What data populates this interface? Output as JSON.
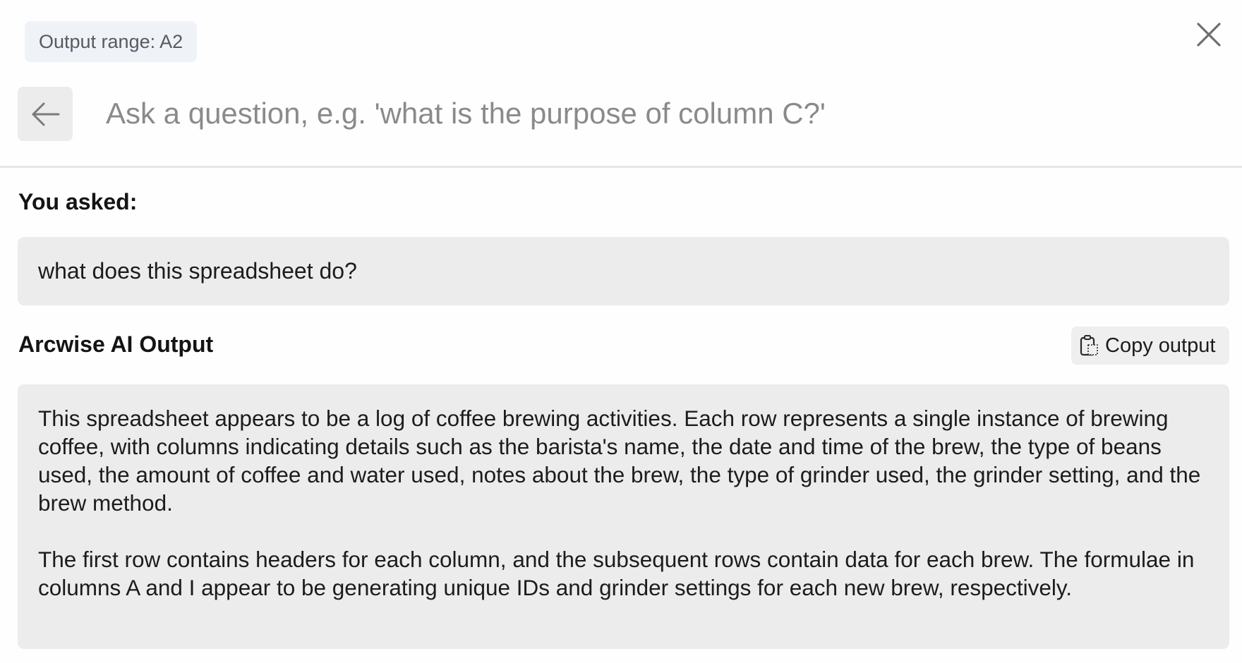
{
  "header": {
    "output_range_label": "Output range: A2",
    "close_icon": "close-icon"
  },
  "ask": {
    "back_icon": "arrow-left-icon",
    "placeholder": "Ask a question, e.g. 'what is the purpose of column C?'",
    "value": ""
  },
  "question": {
    "label": "You asked:",
    "text": "what does this spreadsheet do?"
  },
  "output": {
    "label": "Arcwise AI Output",
    "copy_button": {
      "icon": "clipboard-copy-icon",
      "label": "Copy output"
    },
    "paragraphs": [
      "This spreadsheet appears to be a log of coffee brewing activities. Each row represents a single instance of brewing coffee, with columns indicating details such as the barista's name, the date and time of the brew, the type of beans used, the amount of coffee and water used, notes about the brew, the type of grinder used, the grinder setting, and the brew method.",
      "The first row contains headers for each column, and the subsequent rows contain data for each brew. The formulae in columns A and I appear to be generating unique IDs and grinder settings for each new brew, respectively."
    ]
  }
}
